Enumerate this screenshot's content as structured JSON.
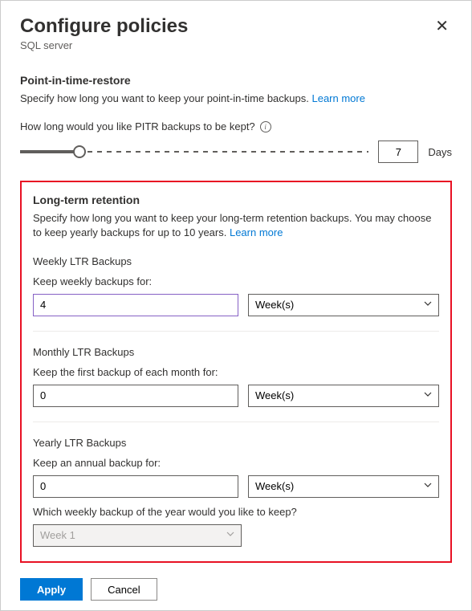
{
  "header": {
    "title": "Configure policies",
    "subtitle": "SQL server"
  },
  "pitr": {
    "title": "Point-in-time-restore",
    "desc": "Specify how long you want to keep your point-in-time backups. ",
    "learn_more": "Learn more",
    "slider_label": "How long would you like PITR backups to be kept?",
    "value": "7",
    "unit": "Days"
  },
  "ltr": {
    "title": "Long-term retention",
    "desc": "Specify how long you want to keep your long-term retention backups. You may choose to keep yearly backups for up to 10 years. ",
    "learn_more": "Learn more",
    "weekly": {
      "title": "Weekly LTR Backups",
      "keep": "Keep weekly backups for:",
      "value": "4",
      "unit": "Week(s)"
    },
    "monthly": {
      "title": "Monthly LTR Backups",
      "keep": "Keep the first backup of each month for:",
      "value": "0",
      "unit": "Week(s)"
    },
    "yearly": {
      "title": "Yearly LTR Backups",
      "keep": "Keep an annual backup for:",
      "value": "0",
      "unit": "Week(s)",
      "which_q": "Which weekly backup of the year would you like to keep?",
      "which_val": "Week 1"
    }
  },
  "footer": {
    "apply": "Apply",
    "cancel": "Cancel"
  }
}
